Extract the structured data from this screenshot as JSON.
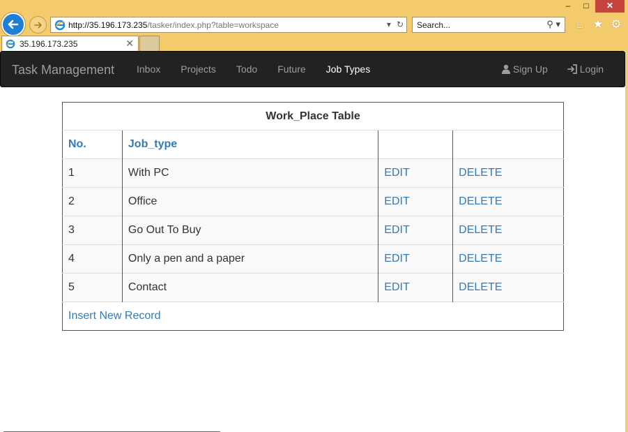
{
  "browser": {
    "address": {
      "host": "http://35.196.173.235",
      "path": "/tasker/index.php?table=workspace"
    },
    "search_placeholder": "Search...",
    "tab_title": "35.196.173.235",
    "icons": {
      "back": "back-arrow-icon",
      "forward": "forward-arrow-icon",
      "refresh": "refresh-icon",
      "search": "magnifier-icon",
      "home": "home-icon",
      "favorites": "star-icon",
      "settings": "gear-icon",
      "close_tab": "close-icon"
    }
  },
  "navbar": {
    "brand": "Task Management",
    "links": [
      {
        "label": "Inbox",
        "active": false
      },
      {
        "label": "Projects",
        "active": false
      },
      {
        "label": "Todo",
        "active": false
      },
      {
        "label": "Future",
        "active": false
      },
      {
        "label": "Job Types",
        "active": true
      }
    ],
    "signup_label": "Sign Up",
    "login_label": "Login"
  },
  "table": {
    "title": "Work_Place Table",
    "headers": {
      "no": "No.",
      "job_type": "Job_type"
    },
    "rows": [
      {
        "no": "1",
        "job_type": "With PC",
        "edit": "EDIT",
        "delete": "DELETE"
      },
      {
        "no": "2",
        "job_type": "Office",
        "edit": "EDIT",
        "delete": "DELETE"
      },
      {
        "no": "3",
        "job_type": "Go Out To Buy",
        "edit": "EDIT",
        "delete": "DELETE"
      },
      {
        "no": "4",
        "job_type": "Only a pen and a paper",
        "edit": "EDIT",
        "delete": "DELETE"
      },
      {
        "no": "5",
        "job_type": "Contact",
        "edit": "EDIT",
        "delete": "DELETE"
      }
    ],
    "insert_label": "Insert New Record"
  },
  "colors": {
    "navbar_bg": "#222222",
    "link": "#337ab7",
    "chrome": "#f3cb6c"
  }
}
